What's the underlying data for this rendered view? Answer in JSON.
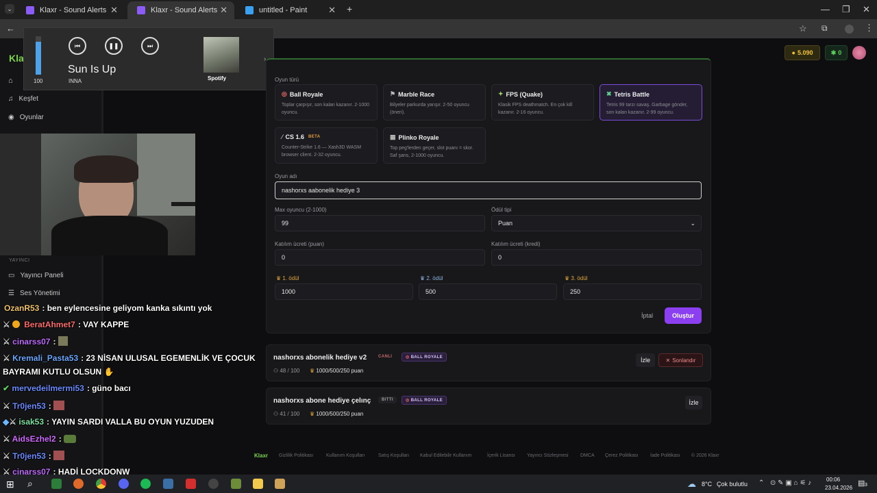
{
  "browser": {
    "tabs": [
      {
        "label": "Klaxr - Sound Alerts"
      },
      {
        "label": "Klaxr - Sound Alerts"
      },
      {
        "label": "untitled - Paint"
      }
    ]
  },
  "media": {
    "volume": "100",
    "title": "Sun Is Up",
    "artist": "INNA",
    "source": "Spotify"
  },
  "header": {
    "points": "5.090",
    "credits": "0"
  },
  "sidebar": {
    "logo": "Kla",
    "items": [
      {
        "label": "Keşfet"
      },
      {
        "label": "Oyunlar"
      }
    ],
    "section_label": "YAYINCI",
    "streamer_items": [
      {
        "label": "Yayıncı Paneli"
      },
      {
        "label": "Ses Yönetimi"
      }
    ]
  },
  "form": {
    "game_type_label": "Oyun türü",
    "games": [
      {
        "name": "Ball Royale",
        "desc": "Toplar çarpışır, son kalan kazanır. 2-1000 oyuncu."
      },
      {
        "name": "Marble Race",
        "desc": "Bilyeler parkurda yarışır. 2-50 oyuncu (öneri)."
      },
      {
        "name": "FPS (Quake)",
        "desc": "Klasik FPS deathmatch. En çok kill kazanır. 2-16 oyuncu."
      },
      {
        "name": "Tetris Battle",
        "desc": "Tetris 99 tarzı savaş. Garbage gönder, son kalan kazanır. 2-99 oyuncu."
      },
      {
        "name": "CS 1.6",
        "badge": "BETA",
        "desc": "Counter-Strike 1.6 — Xash3D WASM browser client. 2-32 oyuncu."
      },
      {
        "name": "Plinko Royale",
        "desc": "Top peg'lerden geçer, slot puanı = skor. Saf şans, 2-1000 oyuncu."
      }
    ],
    "game_name_label": "Oyun adı",
    "game_name_value": "nashorxs aabonelik hediye 3",
    "max_players_label": "Max oyuncu (2-1000)",
    "max_players_value": "99",
    "reward_type_label": "Ödül tipi",
    "reward_type_value": "Puan",
    "entry_fee_points_label": "Katılım ücreti (puan)",
    "entry_fee_points_value": "0",
    "entry_fee_credits_label": "Katılım ücreti (kredi)",
    "entry_fee_credits_value": "0",
    "prize1_label": "1. ödül",
    "prize1_value": "1000",
    "prize2_label": "2. ödül",
    "prize2_value": "500",
    "prize3_label": "3. ödül",
    "prize3_value": "250",
    "cancel_label": "İptal",
    "create_label": "Oluştur"
  },
  "games_list": [
    {
      "title": "nashorxs abonelik hediye v2",
      "status": "CANLI",
      "type": "BALL ROYALE",
      "players": "48 / 100",
      "prizes": "1000/500/250 puan",
      "watch": "İzle",
      "end": "Sonlandır"
    },
    {
      "title": "nashorxs abone hediye çelınç",
      "status": "BITTI",
      "type": "BALL ROYALE",
      "players": "41 / 100",
      "prizes": "1000/500/250 puan",
      "watch": "İzle"
    }
  ],
  "footer": {
    "brand": "Klaxr",
    "links": [
      "Gizlilik Politikası",
      "Kullanım Koşulları",
      "Satış Koşulları",
      "Kabul Edilebilir Kullanım",
      "İçerik Lisansı",
      "Yayıncı Sözleşmesi",
      "DMCA",
      "Çerez Politikası",
      "İade Politikası",
      "© 2026 Klaxr"
    ]
  },
  "chat": [
    {
      "user": "OzanR53",
      "msg": ": ben eylencesine geliyom kanka sıkıntı yok",
      "color": "#f0c36b"
    },
    {
      "user": "BeratAhmet7",
      "msg": ": VAY KAPPE",
      "color": "#ff6b6b"
    },
    {
      "user": "cinarss07",
      "msg": ":",
      "color": "#c06bff"
    },
    {
      "user": "Kremali_Pasta53",
      "msg": ": 23 NİSAN ULUSAL EGEMENLİK VE ÇOCUK",
      "color": "#6ba8ff"
    },
    {
      "user": "",
      "msg": "BAYRAMI KUTLU OLSUN",
      "color": "#ffffff"
    },
    {
      "user": "mervedeilmermi53",
      "msg": ": güno bacı",
      "color": "#6b8cff"
    },
    {
      "user": "Tr0jen53",
      "msg": ":",
      "color": "#6b8cff"
    },
    {
      "user": "isak53",
      "msg": ": YAYIN SARDI VALLA BU OYUN YUZUDEN",
      "color": "#7ee0a0"
    },
    {
      "user": "AidsEzhel2",
      "msg": ":",
      "color": "#d16bff"
    },
    {
      "user": "Tr0jen53",
      "msg": ":",
      "color": "#6b8cff"
    },
    {
      "user": "cinarss07",
      "msg": ": HADİ LOCKDONW",
      "color": "#c06bff"
    }
  ],
  "taskbar": {
    "weather_temp": "8°C",
    "weather_desc": "Çok bulutlu",
    "time": "00:06",
    "date": "23.04.2026",
    "notif_count": "3"
  }
}
